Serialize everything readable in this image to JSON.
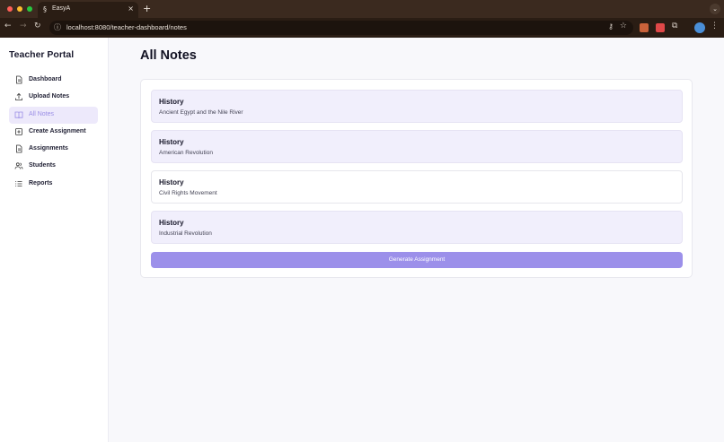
{
  "browser": {
    "tab_title": "EasyA",
    "tab_favicon": "§",
    "url": "localhost:8080/teacher-dashboard/notes",
    "new_tab_glyph": "+",
    "close_glyph": "×"
  },
  "sidebar": {
    "brand": "Teacher Portal",
    "items": [
      {
        "label": "Dashboard",
        "icon": "document-icon",
        "active": false
      },
      {
        "label": "Upload Notes",
        "icon": "upload-icon",
        "active": false
      },
      {
        "label": "All Notes",
        "icon": "book-icon",
        "active": true
      },
      {
        "label": "Create Assignment",
        "icon": "plus-square-icon",
        "active": false
      },
      {
        "label": "Assignments",
        "icon": "document-icon",
        "active": false
      },
      {
        "label": "Students",
        "icon": "users-icon",
        "active": false
      },
      {
        "label": "Reports",
        "icon": "list-icon",
        "active": false
      }
    ]
  },
  "main": {
    "title": "All Notes",
    "notes": [
      {
        "subject": "History",
        "title": "Ancient Egypt and the Nile River",
        "highlighted": true
      },
      {
        "subject": "History",
        "title": "American Revolution",
        "highlighted": true
      },
      {
        "subject": "History",
        "title": "Civil Rights Movement",
        "highlighted": false
      },
      {
        "subject": "History",
        "title": "Industrial Revolution",
        "highlighted": true
      }
    ],
    "generate_button": "Generate Assignment"
  },
  "colors": {
    "accent": "#9c90ea",
    "active_nav_bg": "#ede9fb",
    "note_highlight_bg": "#f1effc"
  }
}
